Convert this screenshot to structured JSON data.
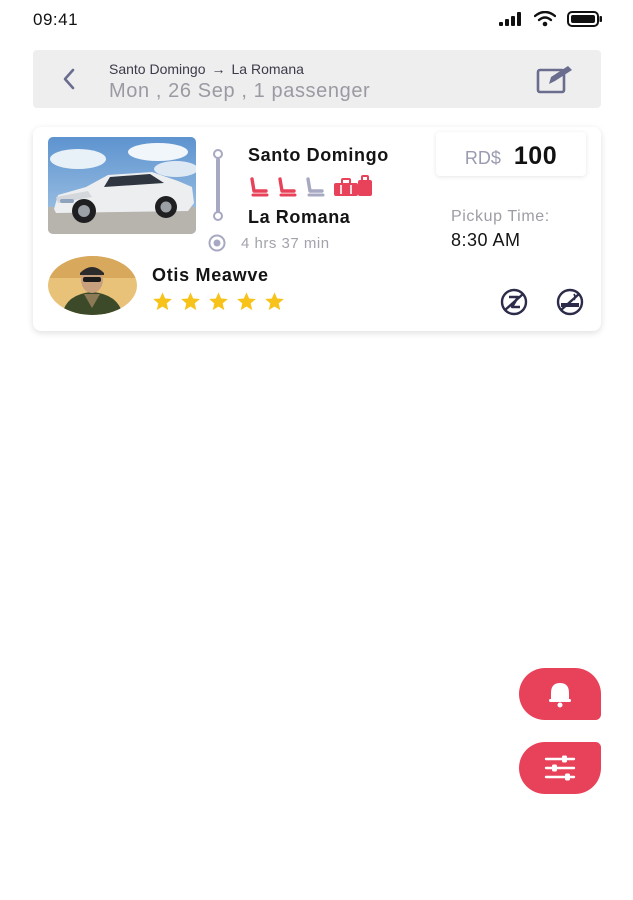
{
  "status_bar": {
    "time": "09:41",
    "icons": [
      "cellular-signal-icon",
      "wifi-icon",
      "battery-icon"
    ]
  },
  "search_summary": {
    "from": "Santo Domingo",
    "arrow": "→",
    "to": "La Romana",
    "meta": "Mon , 26 Sep , 1 passenger",
    "back_icon": "chevron-left-icon",
    "edit_icon": "edit-icon"
  },
  "ride": {
    "from_city": "Santo Domingo",
    "to_city": "La Romana",
    "duration": "4 hrs 37 min",
    "currency": "RD$",
    "price": "100",
    "pickup_label": "Pickup Time:",
    "pickup_time": "8:30 AM",
    "seats": {
      "total": 3,
      "taken": 2
    },
    "amenities": [
      "seat-icon",
      "seat-icon",
      "seat-icon",
      "luggage-icon"
    ],
    "driver": {
      "name": "Otis Meawve",
      "rating": 5,
      "max_rating": 5
    },
    "preferences": [
      "no-pets-icon",
      "no-smoking-icon"
    ]
  },
  "actions": {
    "alert_icon": "bell-icon",
    "filter_icon": "sliders-icon"
  },
  "colors": {
    "accent": "#e8425a",
    "star": "#f7c21a",
    "header_bg": "#eeeeee",
    "muted": "#a7a9c2"
  }
}
